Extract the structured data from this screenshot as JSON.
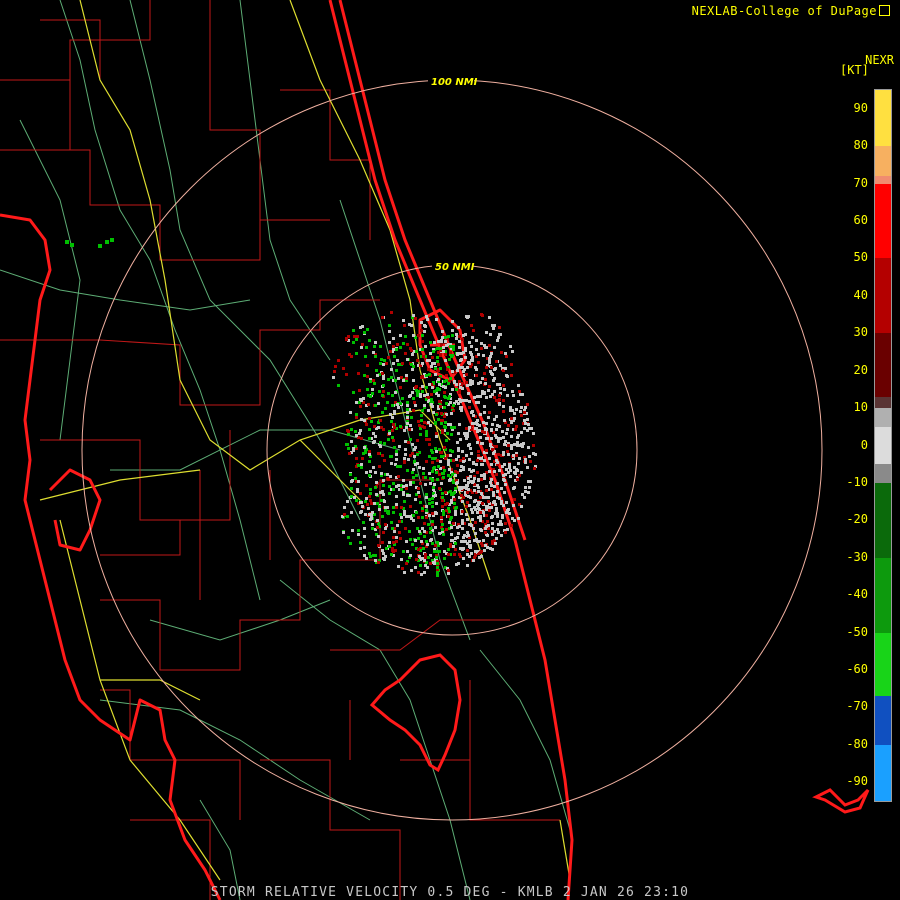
{
  "header": {
    "credit": "NEXLAB-College of DuPage",
    "product_tag": "NEXR",
    "unit": "[KT]"
  },
  "footer": {
    "caption": "STORM RELATIVE VELOCITY 0.5 DEG - KMLB 2 JAN 26 23:10"
  },
  "map": {
    "range_rings": [
      {
        "label": "100 NMI"
      },
      {
        "label": "50 NMI"
      }
    ],
    "colors": {
      "coastline": "#ff1a1a",
      "county_lines": "#c01818",
      "roads": "#dede30",
      "rivers": "#6ecc8a",
      "range_ring": "#f0b0a0",
      "inbound": "#00c000",
      "outbound": "#b00000",
      "near_zero": "#c8c8c8"
    }
  },
  "legend": {
    "ticks": [
      "90",
      "80",
      "70",
      "60",
      "50",
      "40",
      "30",
      "20",
      "10",
      "0",
      "-10",
      "-20",
      "-30",
      "-40",
      "-50",
      "-60",
      "-70",
      "-80",
      "-90"
    ],
    "bands": [
      {
        "from": 95,
        "to": 80,
        "color": "#ffe040"
      },
      {
        "from": 80,
        "to": 72,
        "color": "#f7b060"
      },
      {
        "from": 72,
        "to": 70,
        "color": "#f08c70"
      },
      {
        "from": 70,
        "to": 50,
        "color": "#ff0000"
      },
      {
        "from": 50,
        "to": 30,
        "color": "#b40000"
      },
      {
        "from": 30,
        "to": 13,
        "color": "#6a0000"
      },
      {
        "from": 13,
        "to": 10,
        "color": "#5a3434"
      },
      {
        "from": 10,
        "to": 5,
        "color": "#b0b0b0"
      },
      {
        "from": 5,
        "to": -5,
        "color": "#dcdcdc"
      },
      {
        "from": -5,
        "to": -10,
        "color": "#8a8a8a"
      },
      {
        "from": -10,
        "to": -30,
        "color": "#0b6a0b"
      },
      {
        "from": -30,
        "to": -50,
        "color": "#0d9a0d"
      },
      {
        "from": -50,
        "to": -67,
        "color": "#18d418"
      },
      {
        "from": -67,
        "to": -80,
        "color": "#1050c0"
      },
      {
        "from": -80,
        "to": -95,
        "color": "#1aa0ff"
      }
    ]
  }
}
